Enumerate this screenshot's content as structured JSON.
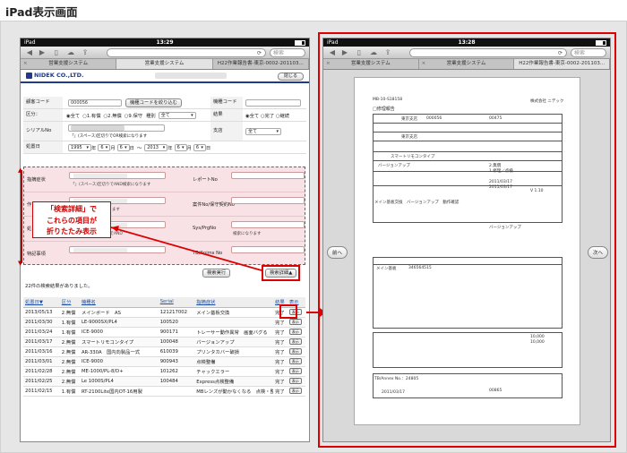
{
  "page_title": "iPad表示画面",
  "status": {
    "carrier": "iPad",
    "time": "13:29",
    "time2": "13:28"
  },
  "browser": {
    "url_suffix": "...",
    "search_placeholder": "検索",
    "tabs": [
      "営業支援システム",
      "営業支援システム",
      "H22作業報告書-東京-0002-201103..."
    ]
  },
  "header": {
    "logo": "NIDEK CO.,LTD.",
    "close_label": "閉じる"
  },
  "form": {
    "customer_code_label": "顧客コード",
    "customer_code_value": "000056",
    "narrow_button": "機種コードを絞り込む",
    "model_code_label": "機種コード",
    "category_label": "区分：",
    "category_options": [
      "全て",
      "1.有償",
      "2.無償",
      "9.保守"
    ],
    "type_label": "種別",
    "type_value": "全て",
    "result_label": "結果",
    "result_options": [
      "全て",
      "完了",
      "継続"
    ],
    "serial_label": "シリアルNo",
    "serial_note": "「」(スペース)区切りでOR検索になります",
    "branch_label": "支店",
    "branch_value": "全て",
    "date_label": "処置日",
    "date_from": {
      "y": "1995",
      "m": "6",
      "d": "6"
    },
    "date_to": {
      "y": "2013",
      "m": "6",
      "d": "6"
    },
    "date_unit_y": "年",
    "date_unit_m": "月",
    "date_unit_d": "日",
    "date_sep": "〜"
  },
  "hidden": {
    "row1": {
      "label": "指摘症状",
      "note": "「」(スペース)区切りでAND検索になります",
      "label2": "レポートNo"
    },
    "row2": {
      "label": "作",
      "note": "「」でAND検索になります",
      "label2": "案件No/保守契約No"
    },
    "row3": {
      "label": "処",
      "note": "「」(スペース)区切りでAND",
      "label2": "Sys/PrgNo",
      "note2": "検索になります"
    },
    "row4": {
      "label": "特記事項",
      "label2": "TB/Anims No"
    }
  },
  "callout": {
    "line1": "「検索詳細」で",
    "line2": "これらの項目が",
    "line3": "折りたたみ表示"
  },
  "buttons": {
    "search": "検索実行",
    "detail": "検索詳細▲"
  },
  "result_count": "22件の検索結果がありました。",
  "table": {
    "headers": [
      "処置日▼",
      "区分",
      "機種名",
      "Serial",
      "指摘症状",
      "結果",
      "表示"
    ],
    "rows": [
      [
        "2013/05/13",
        "2.無償",
        "メインボード　AS",
        "121217002",
        "メイン基板交換",
        "完了"
      ],
      [
        "2011/03/30",
        "1.有償",
        "LE-9000SX/PL4",
        "100520",
        "",
        "完了"
      ],
      [
        "2011/03/24",
        "1.有償",
        "ICE-9000",
        "900171",
        "トレーサー動作異常　画面バグる",
        "完了"
      ],
      [
        "2011/03/17",
        "2.無償",
        "スマートリモコンタイプ",
        "100048",
        "バージョンアップ",
        "完了"
      ],
      [
        "2011/03/16",
        "2.無償",
        "AR-330A　国内向製品一式",
        "610039",
        "プリンタカバー破損",
        "完了"
      ],
      [
        "2011/03/01",
        "2.無償",
        "ICE-9000",
        "900943",
        "点検整備",
        "完了"
      ],
      [
        "2011/02/28",
        "2.無償",
        "ME-1000/PL-8/D+",
        "101262",
        "チャックエラー",
        "完了"
      ],
      [
        "2011/02/25",
        "2.無償",
        "Le 1000S/PL4",
        "100484",
        "Express点検整備",
        "完了"
      ],
      [
        "2011/02/15",
        "1.有償",
        "RT-2100Lite国内OT-16用製",
        "",
        "MBレンズが動かなくなる　点検・整備",
        "完了"
      ]
    ],
    "view_label": "表示"
  },
  "viewer": {
    "prev": "前へ",
    "next": "次へ",
    "doc": {
      "code": "MB-10-S18158",
      "company": "株式会社 ニデック",
      "title": "□修理報告",
      "addr": "東京支店",
      "cust": "000056",
      "no": "00475",
      "office": "東京支店",
      "model": "スマートリモコンタイプ",
      "work": "バージョンアップ",
      "cat": "2.無償",
      "result": "1.修理／点検",
      "date1": "2011/03/17",
      "date2": "2011/03/17",
      "sys": "メイン基板交換　バージョンアップ　動作確認",
      "ver": "V 1.10",
      "detail": "バージョンアップ",
      "part": "メイン基板",
      "partno": "346564515",
      "price": "10,000",
      "price2": "10,000",
      "tb": "TB/Annex No.：24805",
      "rdate": "2011/03/17",
      "rno": "00865"
    }
  },
  "colors": {
    "accent_red": "#d00000",
    "brand_blue": "#1e3a8a"
  }
}
